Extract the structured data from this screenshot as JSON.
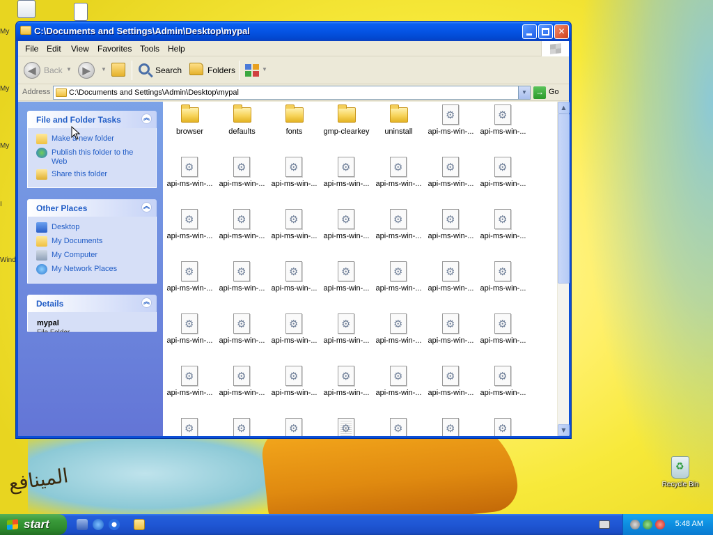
{
  "window": {
    "title": "C:\\Documents and Settings\\Admin\\Desktop\\mypal"
  },
  "menu": [
    "File",
    "Edit",
    "View",
    "Favorites",
    "Tools",
    "Help"
  ],
  "toolbar": {
    "back_label": "Back",
    "search_label": "Search",
    "folders_label": "Folders"
  },
  "address": {
    "label": "Address",
    "value": "C:\\Documents and Settings\\Admin\\Desktop\\mypal",
    "go_label": "Go"
  },
  "tasks": {
    "title": "File and Folder Tasks",
    "links": [
      "Make a new folder",
      "Publish this folder to the Web",
      "Share this folder"
    ]
  },
  "places": {
    "title": "Other Places",
    "links": [
      "Desktop",
      "My Documents",
      "My Computer",
      "My Network Places"
    ]
  },
  "details": {
    "title": "Details",
    "name": "mypal",
    "subtitle": "File Folder"
  },
  "files": [
    {
      "name": "browser",
      "type": "folder"
    },
    {
      "name": "defaults",
      "type": "folder"
    },
    {
      "name": "fonts",
      "type": "folder"
    },
    {
      "name": "gmp-clearkey",
      "type": "folder"
    },
    {
      "name": "uninstall",
      "type": "folder"
    },
    {
      "name": "api-ms-win-...",
      "type": "dll"
    },
    {
      "name": "api-ms-win-...",
      "type": "dll"
    },
    {
      "name": "api-ms-win-...",
      "type": "dll"
    },
    {
      "name": "api-ms-win-...",
      "type": "dll"
    },
    {
      "name": "api-ms-win-...",
      "type": "dll"
    },
    {
      "name": "api-ms-win-...",
      "type": "dll"
    },
    {
      "name": "api-ms-win-...",
      "type": "dll"
    },
    {
      "name": "api-ms-win-...",
      "type": "dll"
    },
    {
      "name": "api-ms-win-...",
      "type": "dll"
    },
    {
      "name": "api-ms-win-...",
      "type": "dll"
    },
    {
      "name": "api-ms-win-...",
      "type": "dll"
    },
    {
      "name": "api-ms-win-...",
      "type": "dll"
    },
    {
      "name": "api-ms-win-...",
      "type": "dll"
    },
    {
      "name": "api-ms-win-...",
      "type": "dll"
    },
    {
      "name": "api-ms-win-...",
      "type": "dll"
    },
    {
      "name": "api-ms-win-...",
      "type": "dll"
    },
    {
      "name": "api-ms-win-...",
      "type": "dll"
    },
    {
      "name": "api-ms-win-...",
      "type": "dll"
    },
    {
      "name": "api-ms-win-...",
      "type": "dll"
    },
    {
      "name": "api-ms-win-...",
      "type": "dll"
    },
    {
      "name": "api-ms-win-...",
      "type": "dll"
    },
    {
      "name": "api-ms-win-...",
      "type": "dll"
    },
    {
      "name": "api-ms-win-...",
      "type": "dll"
    },
    {
      "name": "api-ms-win-...",
      "type": "dll"
    },
    {
      "name": "api-ms-win-...",
      "type": "dll"
    },
    {
      "name": "api-ms-win-...",
      "type": "dll"
    },
    {
      "name": "api-ms-win-...",
      "type": "dll"
    },
    {
      "name": "api-ms-win-...",
      "type": "dll"
    },
    {
      "name": "api-ms-win-...",
      "type": "dll"
    },
    {
      "name": "api-ms-win-...",
      "type": "dll"
    },
    {
      "name": "api-ms-win-...",
      "type": "dll"
    },
    {
      "name": "api-ms-win-...",
      "type": "dll"
    },
    {
      "name": "api-ms-win-...",
      "type": "dll"
    },
    {
      "name": "api-ms-win-...",
      "type": "dll"
    },
    {
      "name": "api-ms-win-...",
      "type": "dll"
    },
    {
      "name": "api-ms-win-...",
      "type": "dll"
    },
    {
      "name": "api-ms-win-...",
      "type": "dll"
    },
    {
      "name": "",
      "type": "dll"
    },
    {
      "name": "",
      "type": "dll"
    },
    {
      "name": "",
      "type": "dll"
    },
    {
      "name": "",
      "type": "config"
    },
    {
      "name": "",
      "type": "dll"
    },
    {
      "name": "",
      "type": "dll"
    },
    {
      "name": "",
      "type": "dll"
    }
  ],
  "desktop": {
    "recycle_bin": "Recycle Bin",
    "stubs": [
      "My",
      "My",
      "My",
      "I",
      "Wind"
    ]
  },
  "taskbar": {
    "start_label": "start",
    "clock": "5:48 AM"
  },
  "colors": {
    "titlebar": "#0554e4",
    "taskpane": "#6375d6",
    "link": "#215dc6",
    "start_button": "#3a9a3a"
  }
}
